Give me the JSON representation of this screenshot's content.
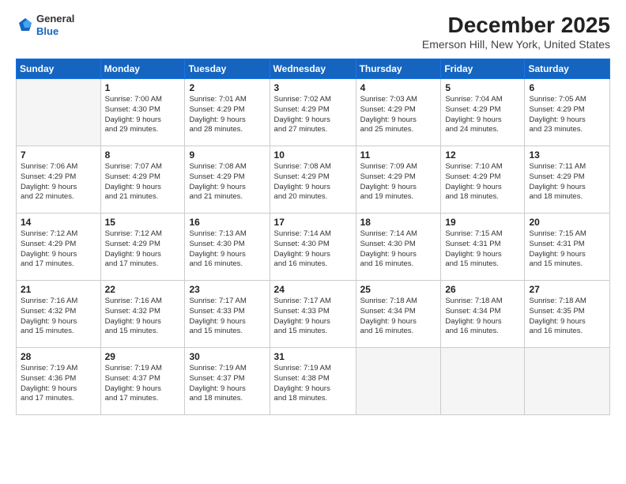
{
  "header": {
    "logo_line1": "General",
    "logo_line2": "Blue",
    "month_title": "December 2025",
    "location": "Emerson Hill, New York, United States"
  },
  "weekdays": [
    "Sunday",
    "Monday",
    "Tuesday",
    "Wednesday",
    "Thursday",
    "Friday",
    "Saturday"
  ],
  "weeks": [
    [
      {
        "day": "",
        "info": ""
      },
      {
        "day": "1",
        "info": "Sunrise: 7:00 AM\nSunset: 4:30 PM\nDaylight: 9 hours\nand 29 minutes."
      },
      {
        "day": "2",
        "info": "Sunrise: 7:01 AM\nSunset: 4:29 PM\nDaylight: 9 hours\nand 28 minutes."
      },
      {
        "day": "3",
        "info": "Sunrise: 7:02 AM\nSunset: 4:29 PM\nDaylight: 9 hours\nand 27 minutes."
      },
      {
        "day": "4",
        "info": "Sunrise: 7:03 AM\nSunset: 4:29 PM\nDaylight: 9 hours\nand 25 minutes."
      },
      {
        "day": "5",
        "info": "Sunrise: 7:04 AM\nSunset: 4:29 PM\nDaylight: 9 hours\nand 24 minutes."
      },
      {
        "day": "6",
        "info": "Sunrise: 7:05 AM\nSunset: 4:29 PM\nDaylight: 9 hours\nand 23 minutes."
      }
    ],
    [
      {
        "day": "7",
        "info": "Sunrise: 7:06 AM\nSunset: 4:29 PM\nDaylight: 9 hours\nand 22 minutes."
      },
      {
        "day": "8",
        "info": "Sunrise: 7:07 AM\nSunset: 4:29 PM\nDaylight: 9 hours\nand 21 minutes."
      },
      {
        "day": "9",
        "info": "Sunrise: 7:08 AM\nSunset: 4:29 PM\nDaylight: 9 hours\nand 21 minutes."
      },
      {
        "day": "10",
        "info": "Sunrise: 7:08 AM\nSunset: 4:29 PM\nDaylight: 9 hours\nand 20 minutes."
      },
      {
        "day": "11",
        "info": "Sunrise: 7:09 AM\nSunset: 4:29 PM\nDaylight: 9 hours\nand 19 minutes."
      },
      {
        "day": "12",
        "info": "Sunrise: 7:10 AM\nSunset: 4:29 PM\nDaylight: 9 hours\nand 18 minutes."
      },
      {
        "day": "13",
        "info": "Sunrise: 7:11 AM\nSunset: 4:29 PM\nDaylight: 9 hours\nand 18 minutes."
      }
    ],
    [
      {
        "day": "14",
        "info": "Sunrise: 7:12 AM\nSunset: 4:29 PM\nDaylight: 9 hours\nand 17 minutes."
      },
      {
        "day": "15",
        "info": "Sunrise: 7:12 AM\nSunset: 4:29 PM\nDaylight: 9 hours\nand 17 minutes."
      },
      {
        "day": "16",
        "info": "Sunrise: 7:13 AM\nSunset: 4:30 PM\nDaylight: 9 hours\nand 16 minutes."
      },
      {
        "day": "17",
        "info": "Sunrise: 7:14 AM\nSunset: 4:30 PM\nDaylight: 9 hours\nand 16 minutes."
      },
      {
        "day": "18",
        "info": "Sunrise: 7:14 AM\nSunset: 4:30 PM\nDaylight: 9 hours\nand 16 minutes."
      },
      {
        "day": "19",
        "info": "Sunrise: 7:15 AM\nSunset: 4:31 PM\nDaylight: 9 hours\nand 15 minutes."
      },
      {
        "day": "20",
        "info": "Sunrise: 7:15 AM\nSunset: 4:31 PM\nDaylight: 9 hours\nand 15 minutes."
      }
    ],
    [
      {
        "day": "21",
        "info": "Sunrise: 7:16 AM\nSunset: 4:32 PM\nDaylight: 9 hours\nand 15 minutes."
      },
      {
        "day": "22",
        "info": "Sunrise: 7:16 AM\nSunset: 4:32 PM\nDaylight: 9 hours\nand 15 minutes."
      },
      {
        "day": "23",
        "info": "Sunrise: 7:17 AM\nSunset: 4:33 PM\nDaylight: 9 hours\nand 15 minutes."
      },
      {
        "day": "24",
        "info": "Sunrise: 7:17 AM\nSunset: 4:33 PM\nDaylight: 9 hours\nand 15 minutes."
      },
      {
        "day": "25",
        "info": "Sunrise: 7:18 AM\nSunset: 4:34 PM\nDaylight: 9 hours\nand 16 minutes."
      },
      {
        "day": "26",
        "info": "Sunrise: 7:18 AM\nSunset: 4:34 PM\nDaylight: 9 hours\nand 16 minutes."
      },
      {
        "day": "27",
        "info": "Sunrise: 7:18 AM\nSunset: 4:35 PM\nDaylight: 9 hours\nand 16 minutes."
      }
    ],
    [
      {
        "day": "28",
        "info": "Sunrise: 7:19 AM\nSunset: 4:36 PM\nDaylight: 9 hours\nand 17 minutes."
      },
      {
        "day": "29",
        "info": "Sunrise: 7:19 AM\nSunset: 4:37 PM\nDaylight: 9 hours\nand 17 minutes."
      },
      {
        "day": "30",
        "info": "Sunrise: 7:19 AM\nSunset: 4:37 PM\nDaylight: 9 hours\nand 18 minutes."
      },
      {
        "day": "31",
        "info": "Sunrise: 7:19 AM\nSunset: 4:38 PM\nDaylight: 9 hours\nand 18 minutes."
      },
      {
        "day": "",
        "info": ""
      },
      {
        "day": "",
        "info": ""
      },
      {
        "day": "",
        "info": ""
      }
    ]
  ]
}
